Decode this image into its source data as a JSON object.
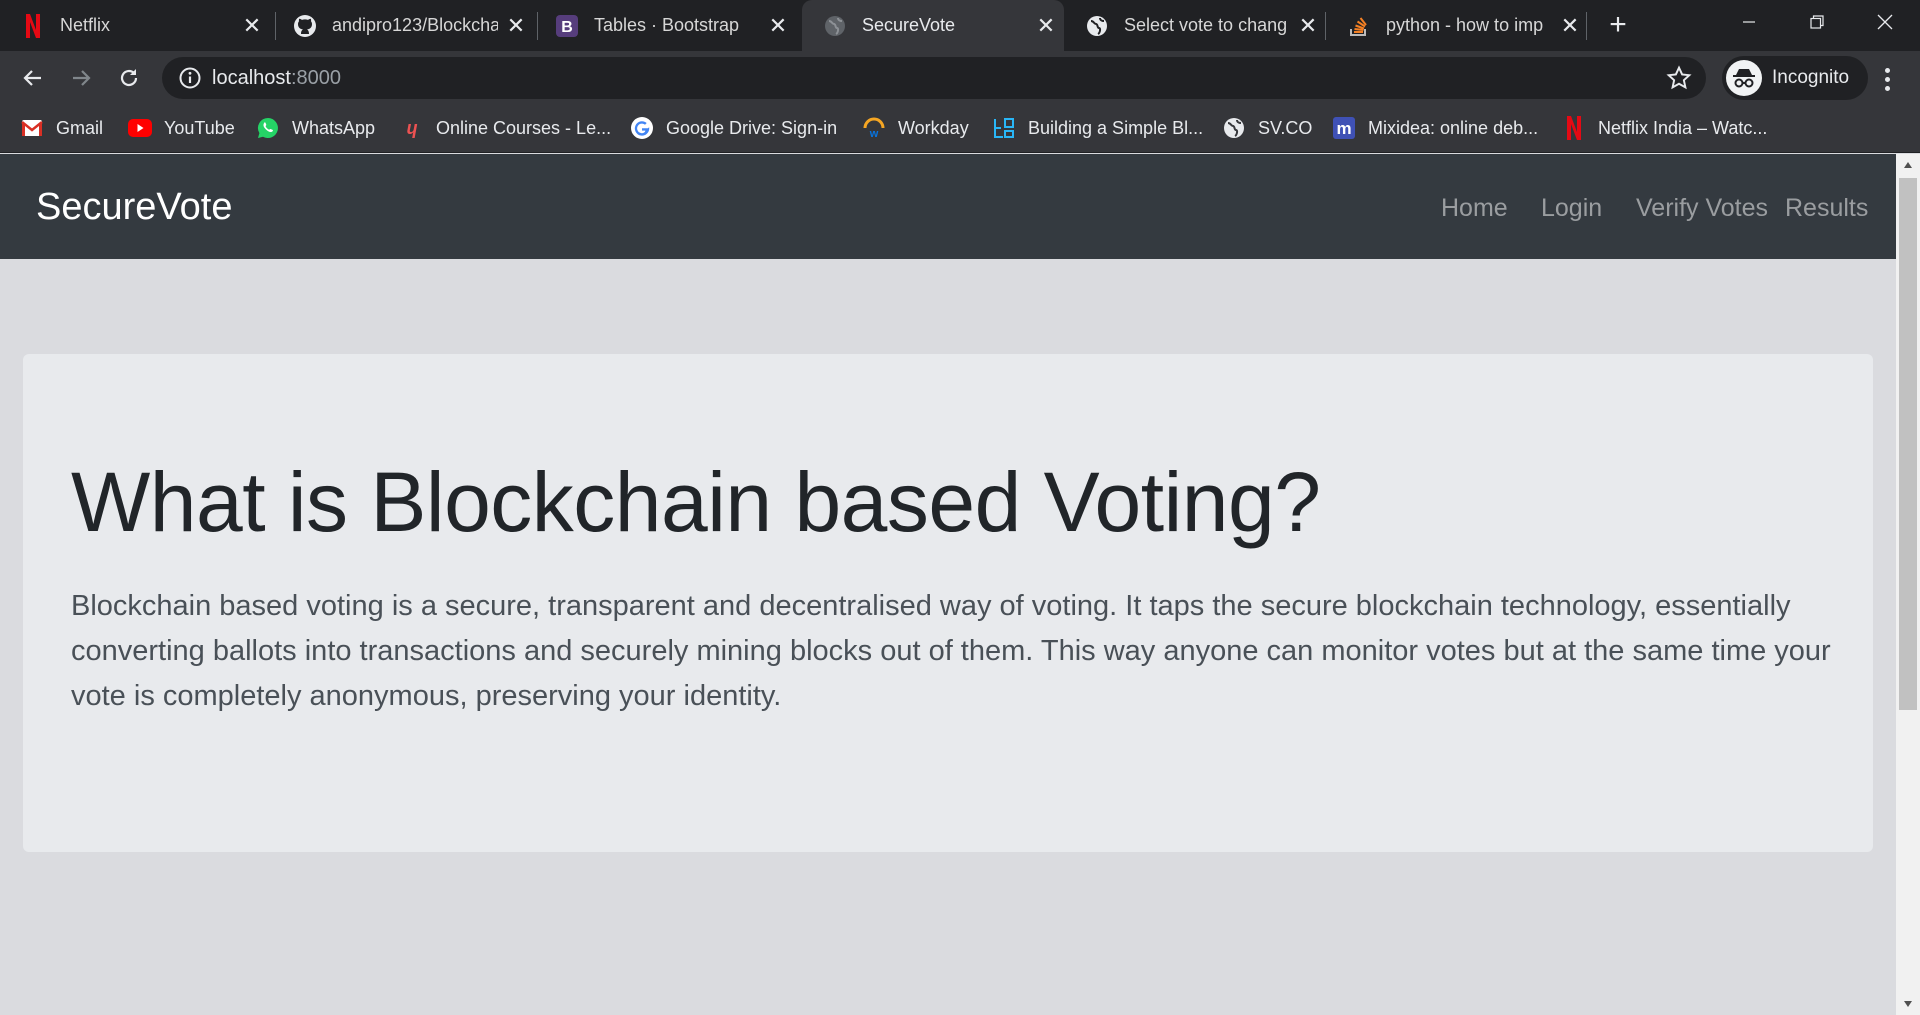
{
  "browser": {
    "tabs": [
      {
        "title": "Netflix",
        "icon": "netflix-icon"
      },
      {
        "title": "andipro123/Blockcha",
        "icon": "github-icon"
      },
      {
        "title": "Tables · Bootstrap",
        "icon": "bootstrap-icon"
      },
      {
        "title": "SecureVote",
        "icon": "globe-icon",
        "active": true
      },
      {
        "title": "Select vote to chang",
        "icon": "globe-icon"
      },
      {
        "title": "python - how to imp",
        "icon": "stackoverflow-icon"
      }
    ],
    "address": {
      "host": "localhost",
      "port": ":8000"
    },
    "profile_label": "Incognito",
    "bookmarks": [
      {
        "label": "Gmail",
        "icon": "gmail-icon"
      },
      {
        "label": "YouTube",
        "icon": "youtube-icon"
      },
      {
        "label": "WhatsApp",
        "icon": "whatsapp-icon"
      },
      {
        "label": "Online Courses - Le...",
        "icon": "udemy-icon"
      },
      {
        "label": "Google Drive: Sign-in",
        "icon": "google-icon"
      },
      {
        "label": "Workday",
        "icon": "workday-icon"
      },
      {
        "label": "Building a Simple Bl...",
        "icon": "bookmark-site-icon"
      },
      {
        "label": "SV.CO",
        "icon": "globe-icon"
      },
      {
        "label": "Mixidea: online deb...",
        "icon": "mixidea-icon"
      },
      {
        "label": "Netflix India – Watc...",
        "icon": "netflix-icon"
      }
    ],
    "colors": {
      "chrome_dark": "#202124",
      "chrome_mid": "#35363a"
    }
  },
  "site": {
    "brand": "SecureVote",
    "nav": [
      "Home",
      "Login",
      "Verify Votes",
      "Results"
    ],
    "hero": {
      "title": "What is Blockchain based Voting?",
      "body": "Blockchain based voting is a secure, transparent and decentralised way of voting. It taps the secure blockchain technology, essentially converting ballots into transactions and securely mining blocks out of them. This way anyone can monitor votes but at the same time your vote is completely anonymous, preserving your identity."
    },
    "colors": {
      "navbar": "#343a40",
      "jumbotron": "#e8eaed",
      "page_bg": "#dadbdf"
    }
  }
}
